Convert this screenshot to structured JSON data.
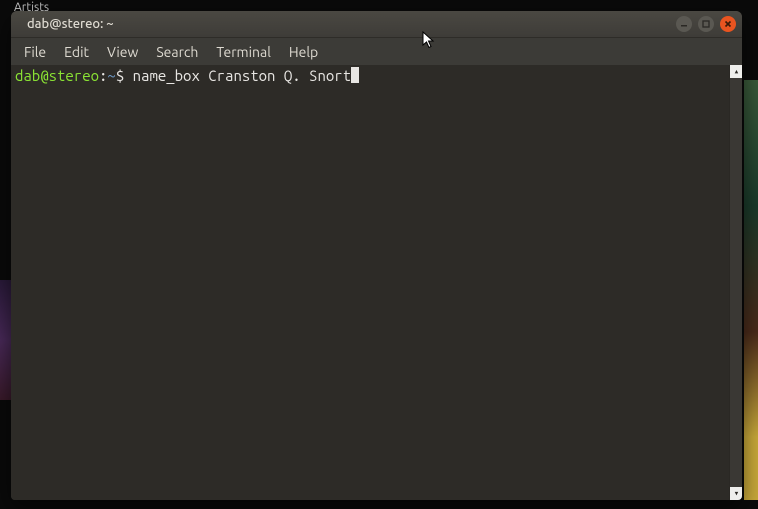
{
  "partial_top": "Artists",
  "window": {
    "title": "dab@stereo: ~"
  },
  "menu": {
    "file": "File",
    "edit": "Edit",
    "view": "View",
    "search": "Search",
    "terminal": "Terminal",
    "help": "Help"
  },
  "prompt": {
    "user_host": "dab@stereo",
    "sep": ":",
    "path": "~",
    "dollar": "$ ",
    "command": "name_box Cranston Q. Snort"
  },
  "scrollbar": {
    "up": "▴",
    "down": "▾"
  }
}
